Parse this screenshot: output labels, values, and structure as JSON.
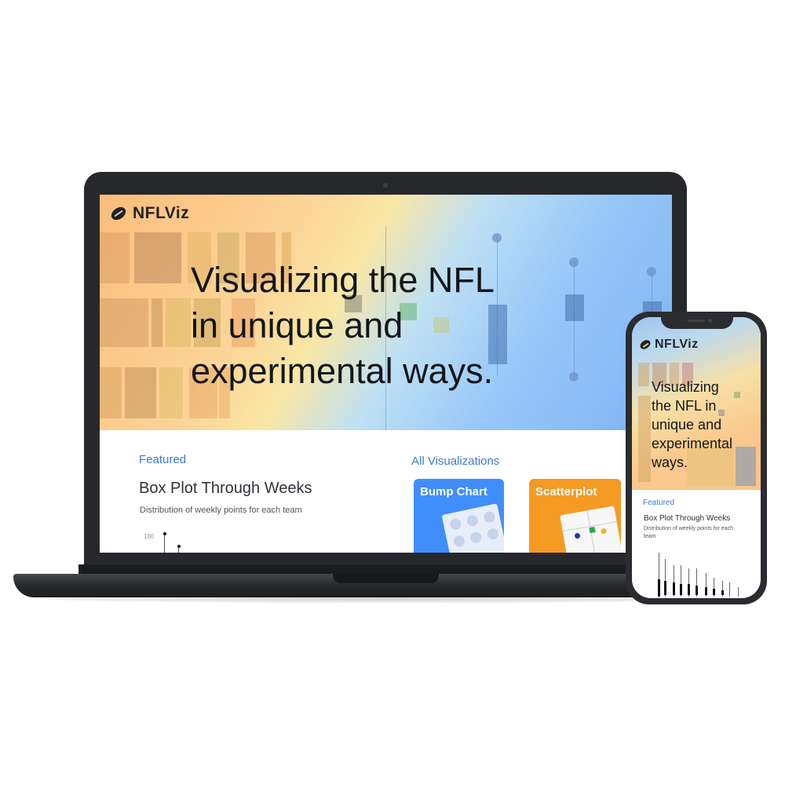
{
  "site": {
    "brand": "NFLViz",
    "football_icon": "football-icon"
  },
  "hero": {
    "title_lines": [
      "Visualizing the NFL",
      "in unique and",
      "experimental ways."
    ]
  },
  "featured": {
    "label": "Featured",
    "title": "Box Plot Through Weeks",
    "subtitle": "Distribution of weekly points for each team",
    "axis_tick": "180"
  },
  "all_visualizations": {
    "label": "All Visualizations",
    "cards": [
      {
        "label": "Bump Chart",
        "color": "#3f8efc"
      },
      {
        "label": "Scatterplot",
        "color": "#f59a23"
      }
    ]
  },
  "mobile": {
    "brand": "NFLViz",
    "hero_title_lines": [
      "Visualizing",
      "the NFL in",
      "unique and",
      "experimental",
      "ways."
    ],
    "featured_label": "Featured",
    "featured_title": "Box Plot Through Weeks",
    "featured_subtitle_lines": [
      "Distribution of weekly points for each",
      "team"
    ]
  },
  "colors": {
    "accent": "#3a7bd5",
    "device_dark": "#27282c",
    "card_blue": "#3f8efc",
    "card_orange": "#f59a23"
  }
}
